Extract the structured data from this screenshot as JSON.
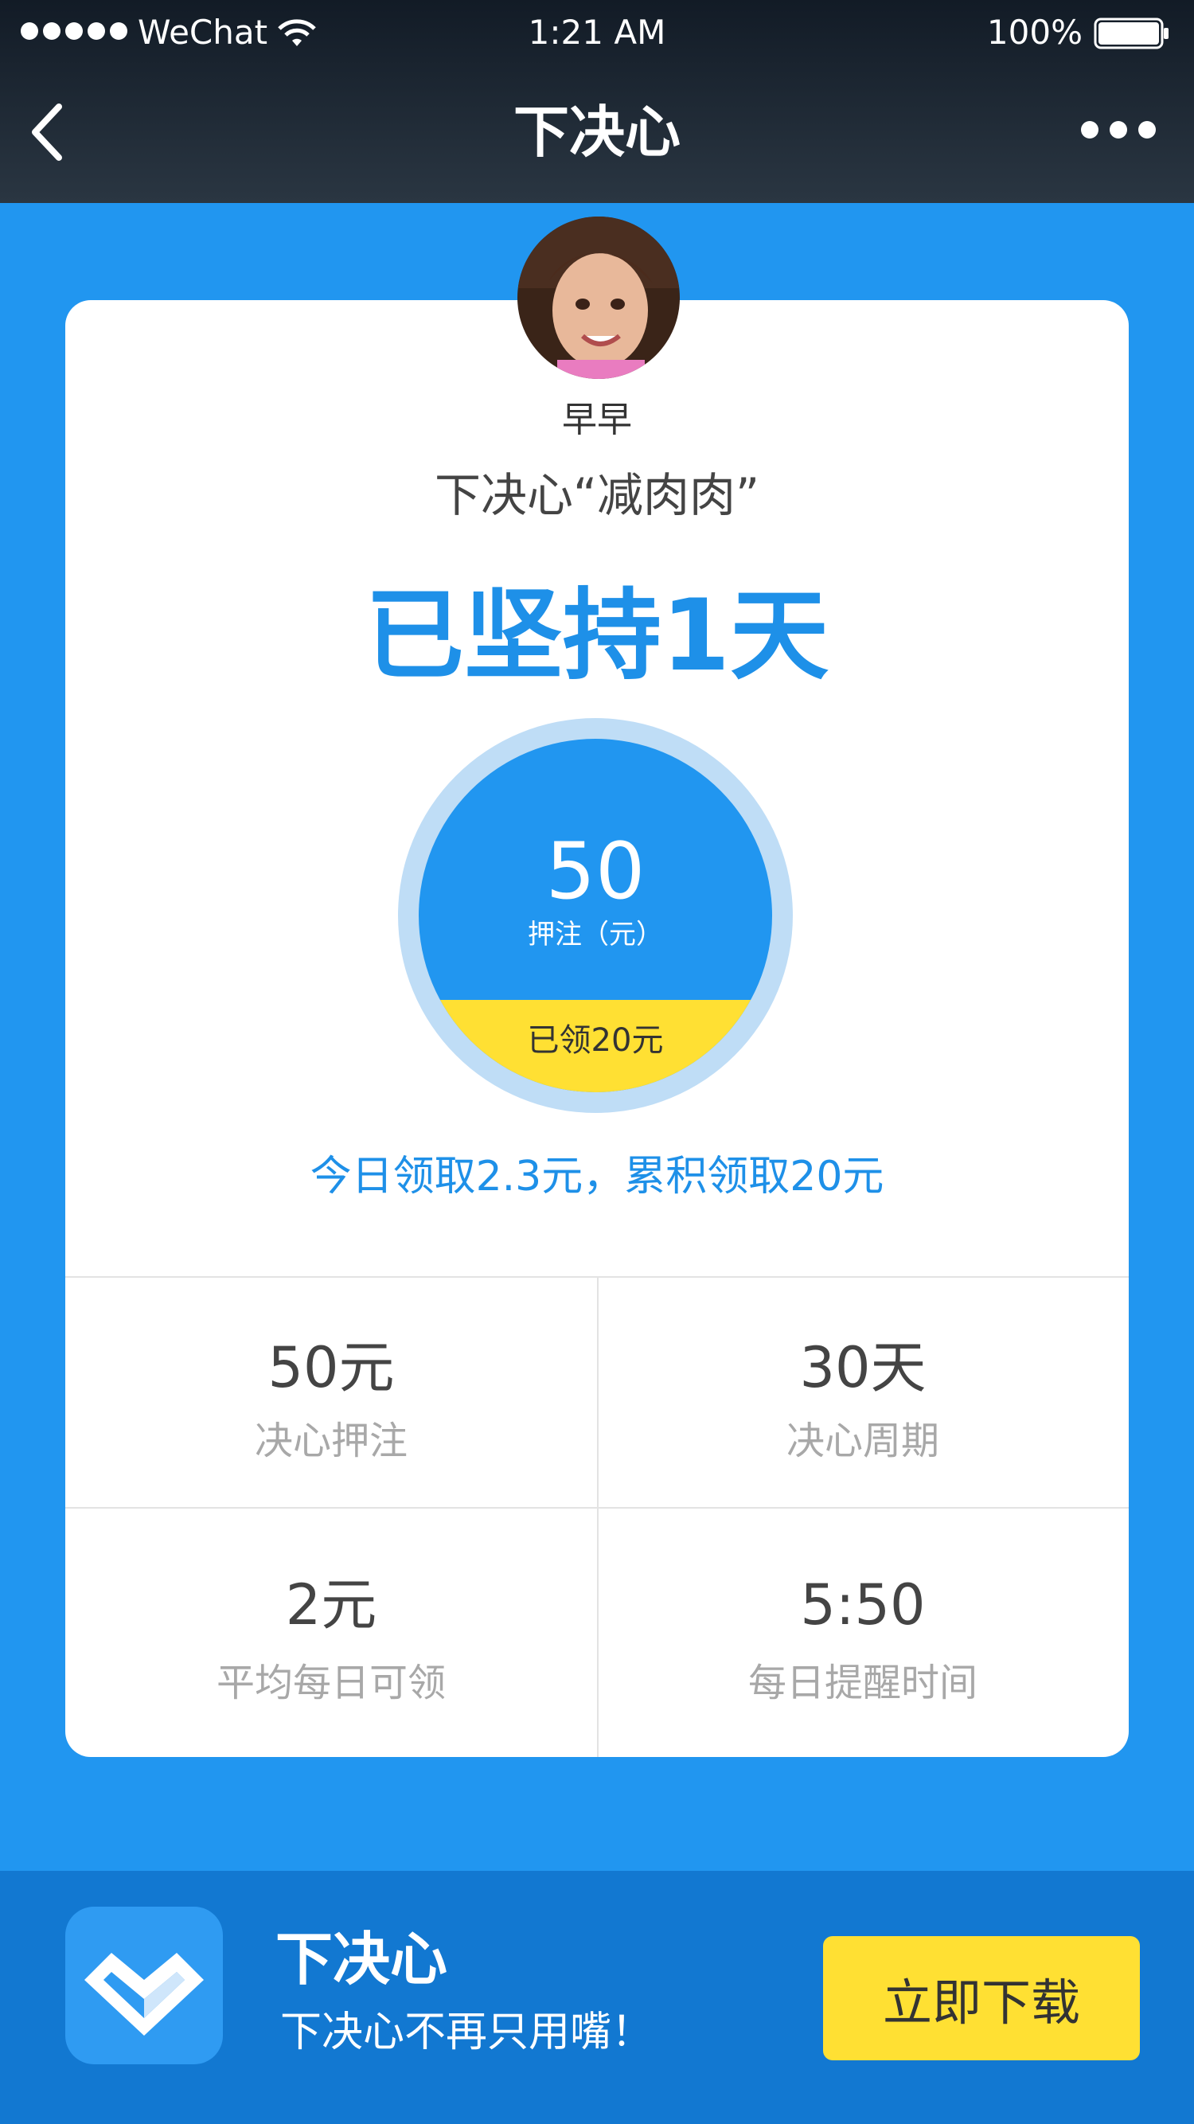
{
  "status_bar": {
    "carrier": "WeChat",
    "time": "1:21 AM",
    "battery": "100%"
  },
  "nav": {
    "title": "下决心"
  },
  "profile": {
    "nickname": "早早",
    "resolution": "下决心“减肉肉”"
  },
  "progress": {
    "persist_text": "已坚持1天",
    "deposit_value": "50",
    "deposit_label": "押注（元）",
    "claimed_text": "已领20元",
    "summary": "今日领取2.3元，累积领取20元"
  },
  "stats": [
    {
      "value": "50元",
      "label": "决心押注"
    },
    {
      "value": "30天",
      "label": "决心周期"
    },
    {
      "value": "2元",
      "label": "平均每日可领"
    },
    {
      "value": "5:50",
      "label": "每日提醒时间"
    }
  ],
  "promo": {
    "app_name": "下决心",
    "tagline": "下决心不再只用嘴！",
    "download_label": "立即下载"
  },
  "colors": {
    "background": "#2196F0",
    "accent_blue": "#1E90E8",
    "claimed_yellow": "#FFE033",
    "promo_bar": "#1278D1"
  }
}
